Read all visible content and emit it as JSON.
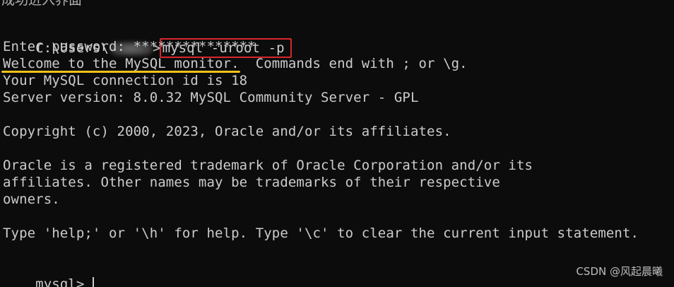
{
  "terminal": {
    "top_cut_text": "成功进入界面",
    "line1": {
      "path_prefix": "C:\\Users\\",
      "path_suffix": ">",
      "command": "mysql -uroot -p"
    },
    "line2": "Enter password: ***************",
    "line3": "Welcome to the MySQL monitor.  Commands end with ; or \\g.",
    "line4": "Your MySQL connection id is 18",
    "line5": "Server version: 8.0.32 MySQL Community Server - GPL",
    "line6": "Copyright (c) 2000, 2023, Oracle and/or its affiliates.",
    "line7": "Oracle is a registered trademark of Oracle Corporation and/or its",
    "line8": "affiliates. Other names may be trademarks of their respective",
    "line9": "owners.",
    "line10": "Type 'help;' or '\\h' for help. Type '\\c' to clear the current input statement.",
    "prompt": "mysql>"
  },
  "watermark": "CSDN @风起晨曦",
  "colors": {
    "background": "#0c0c0c",
    "text": "#cccccc",
    "highlight_box": "#d9262c",
    "underline": "#f2c21b"
  },
  "icons": {
    "redaction": "blurred-username"
  }
}
